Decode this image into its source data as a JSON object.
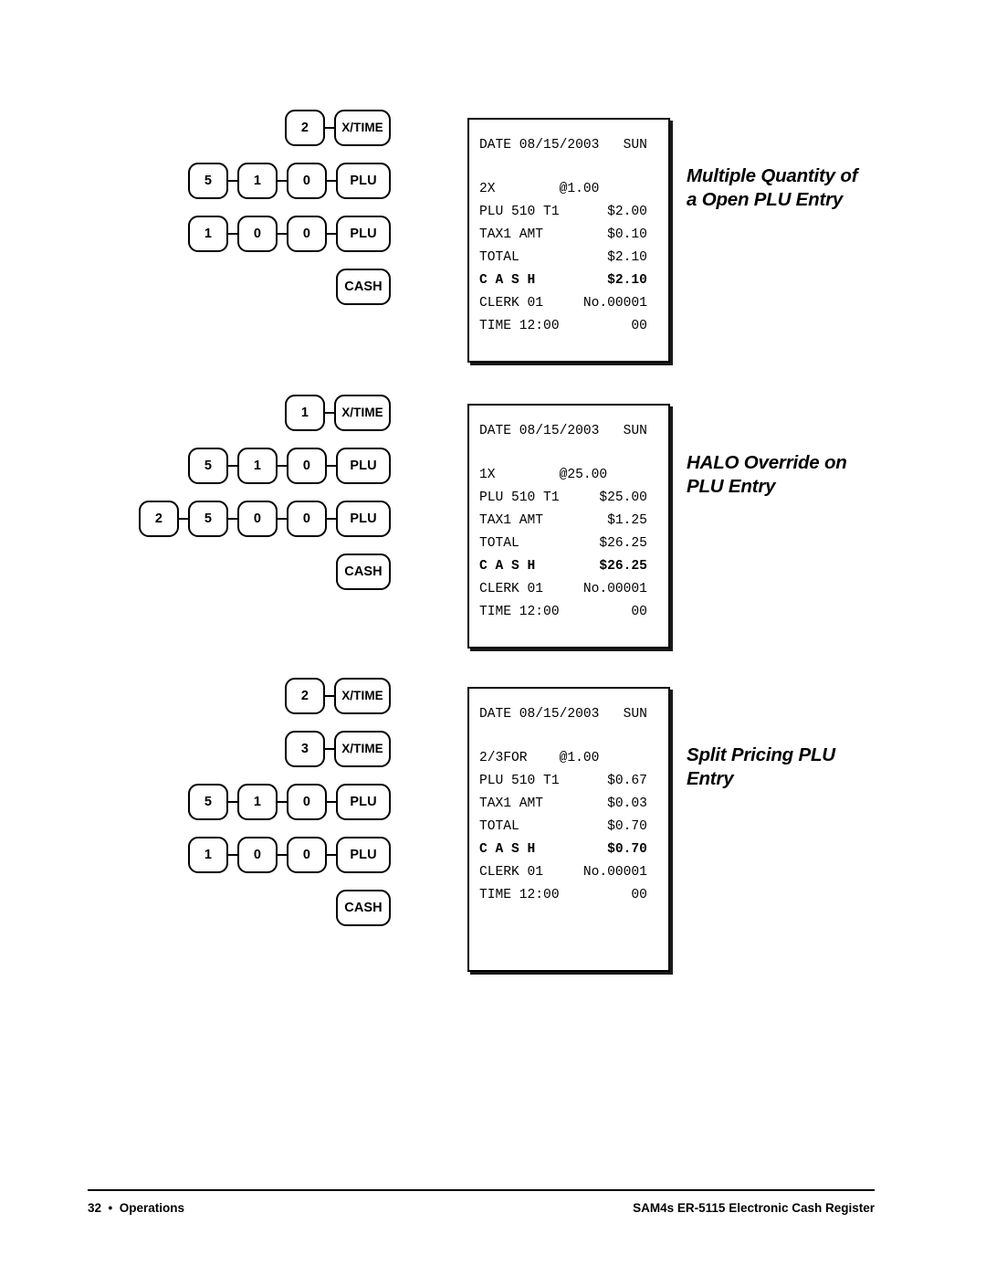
{
  "page": {
    "footer": {
      "page_number": "32",
      "bullet": "•",
      "section": "Operations",
      "left_text": "32  •  Operations",
      "right_text": "SAM4s ER-5115 Electronic Cash Register"
    }
  },
  "examples": [
    {
      "heading_line1": "Multiple Quantity of",
      "heading_line2": "a Open PLU Entry",
      "key_rows": [
        {
          "keys": [
            "2",
            "X/TIME"
          ]
        },
        {
          "keys": [
            "5",
            "1",
            "0",
            "PLU"
          ]
        },
        {
          "keys": [
            "1",
            "0",
            "0",
            "PLU"
          ]
        },
        {
          "keys": [
            "CASH"
          ]
        }
      ],
      "receipt": {
        "date_line": "DATE 08/15/2003   SUN",
        "qty_line": "2X        @1.00",
        "plu_line": "PLU 510 T1      $2.00",
        "tax_line": "TAX1 AMT        $0.10",
        "total_line": "TOTAL           $2.10",
        "cash_line": "C A S H         $2.10",
        "clerk_line": "CLERK 01     No.00001",
        "time_line": "TIME 12:00         00"
      }
    },
    {
      "heading_line1": "HALO Override on",
      "heading_line2": "PLU Entry",
      "key_rows": [
        {
          "keys": [
            "1",
            "X/TIME"
          ]
        },
        {
          "keys": [
            "5",
            "1",
            "0",
            "PLU"
          ]
        },
        {
          "keys": [
            "2",
            "5",
            "0",
            "0",
            "PLU"
          ]
        },
        {
          "keys": [
            "CASH"
          ]
        }
      ],
      "receipt": {
        "date_line": "DATE 08/15/2003   SUN",
        "qty_line": "1X        @25.00",
        "plu_line": "PLU 510 T1     $25.00",
        "tax_line": "TAX1 AMT        $1.25",
        "total_line": "TOTAL          $26.25",
        "cash_line": "C A S H        $26.25",
        "clerk_line": "CLERK 01     No.00001",
        "time_line": "TIME 12:00         00"
      }
    },
    {
      "heading_line1": "Split Pricing PLU",
      "heading_line2": "Entry",
      "key_rows": [
        {
          "keys": [
            "2",
            "X/TIME"
          ]
        },
        {
          "keys": [
            "3",
            "X/TIME"
          ]
        },
        {
          "keys": [
            "5",
            "1",
            "0",
            "PLU"
          ]
        },
        {
          "keys": [
            "1",
            "0",
            "0",
            "PLU"
          ]
        },
        {
          "keys": [
            "CASH"
          ]
        }
      ],
      "receipt": {
        "date_line": "DATE 08/15/2003   SUN",
        "qty_line": "2/3FOR    @1.00",
        "plu_line": "PLU 510 T1      $0.67",
        "tax_line": "TAX1 AMT        $0.03",
        "total_line": "TOTAL           $0.70",
        "cash_line": "C A S H         $0.70",
        "clerk_line": "CLERK 01     No.00001",
        "time_line": "TIME 12:00         00"
      }
    }
  ]
}
